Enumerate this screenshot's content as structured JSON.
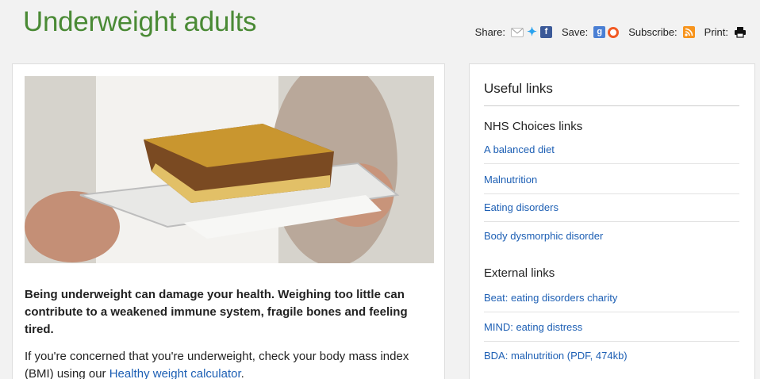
{
  "page": {
    "title": "Underweight adults"
  },
  "toolbar": {
    "share_label": "Share:",
    "save_label": "Save:",
    "subscribe_label": "Subscribe:",
    "print_label": "Print:",
    "icons": [
      "email-icon",
      "twitter-icon",
      "facebook-icon",
      "google-plus-icon",
      "save-circle-icon",
      "rss-icon",
      "printer-icon"
    ]
  },
  "main": {
    "image_alt": "Lasagne on a plate",
    "intro": "Being underweight can damage your health. Weighing too little can contribute to a weakened immune system, fragile bones and feeling tired.",
    "body_prefix": "If you're concerned that you're underweight, check your body mass index (BMI) using our ",
    "body_link": "Healthy weight calculator",
    "body_suffix": "."
  },
  "links": {
    "title": "Useful links",
    "nhs_heading": "NHS Choices links",
    "nhs_items": [
      "A balanced diet",
      "Malnutrition",
      "Eating disorders",
      "Body dysmorphic disorder"
    ],
    "external_heading": "External links",
    "external_items": [
      "Beat: eating disorders charity",
      "MIND: eating distress",
      "BDA: malnutrition (PDF, 474kb)"
    ]
  },
  "colors": {
    "title_green": "#4a8a35",
    "link_blue": "#1d5fb4"
  }
}
